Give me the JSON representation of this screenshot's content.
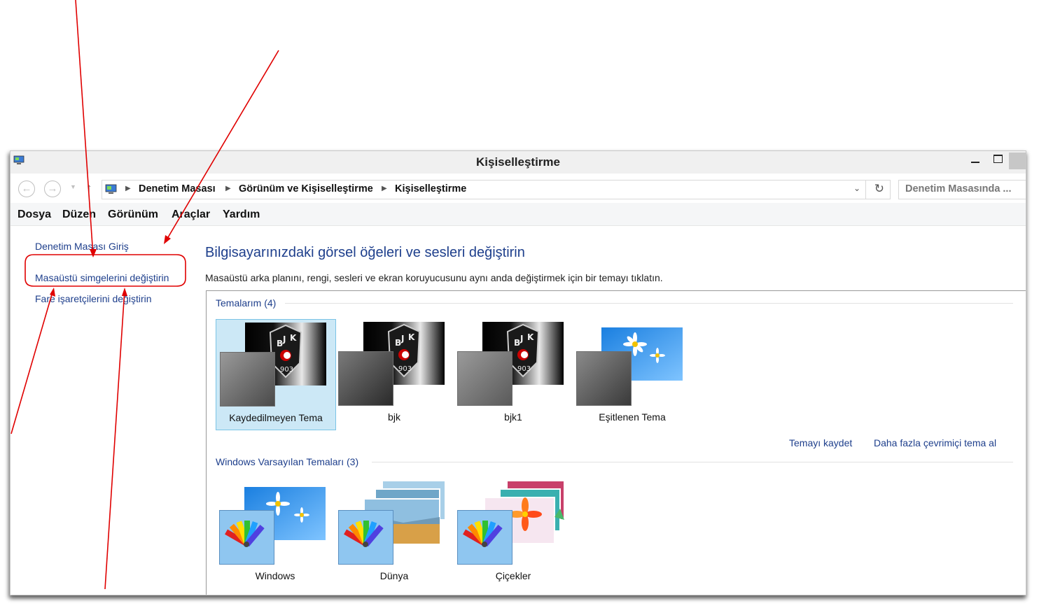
{
  "window": {
    "title": "Kişiselleştirme"
  },
  "address_bar": {
    "breadcrumbs": [
      "Denetim Masası",
      "Görünüm ve Kişiselleştirme",
      "Kişiselleştirme"
    ]
  },
  "search": {
    "placeholder": "Denetim Masasında ..."
  },
  "menu": [
    "Dosya",
    "Düzen",
    "Görünüm",
    "Araçlar",
    "Yardım"
  ],
  "sidebar": {
    "items": [
      {
        "label": "Denetim Masası Giriş"
      },
      {
        "label": "Masaüstü simgelerini değiştirin"
      },
      {
        "label": "Fare işaretçilerini değiştirin"
      }
    ]
  },
  "main": {
    "heading": "Bilgisayarınızdaki görsel öğeleri ve sesleri değiştirin",
    "subtitle": "Masaüstü arka planını, rengi, sesleri ve ekran koruyucusunu aynı anda değiştirmek için bir temayı tıklatın.",
    "my_themes": {
      "title": "Temalarım (4)",
      "themes": [
        {
          "name": "Kaydedilmeyen Tema",
          "selected": true,
          "wallpaper": "bjk-logo"
        },
        {
          "name": "bjk",
          "selected": false,
          "wallpaper": "bjk-logo"
        },
        {
          "name": "bjk1",
          "selected": false,
          "wallpaper": "bjk-logo"
        },
        {
          "name": "Eşitlenen Tema",
          "selected": false,
          "wallpaper": "daisy"
        }
      ],
      "links": {
        "save": "Temayı kaydet",
        "more_online": "Daha fazla çevrimiçi tema al"
      }
    },
    "default_themes": {
      "title": "Windows Varsayılan Temaları (3)",
      "themes": [
        {
          "name": "Windows",
          "wallpaper": "daisy"
        },
        {
          "name": "Dünya",
          "wallpaper": "landscape"
        },
        {
          "name": "Çiçekler",
          "wallpaper": "flowers"
        }
      ]
    }
  },
  "colors": {
    "link": "#1e3f8c",
    "selection": "#cce8f6",
    "annotation": "#e00000"
  }
}
